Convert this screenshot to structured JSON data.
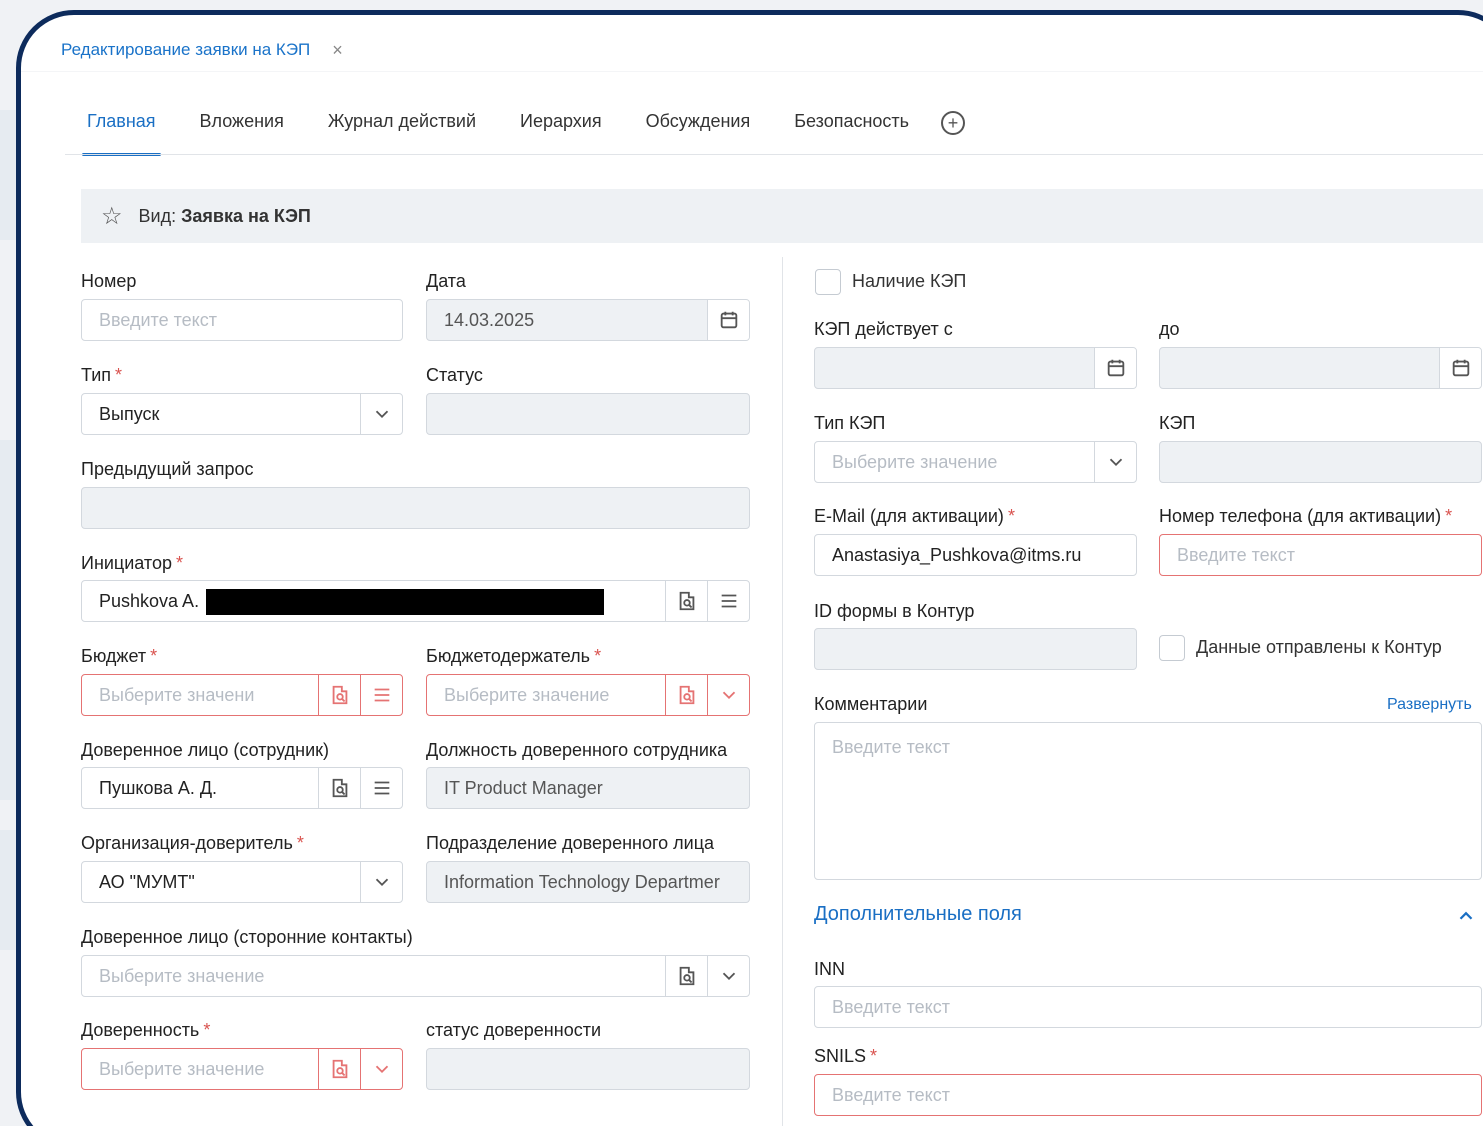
{
  "doc_tab": {
    "title": "Редактирование заявки на КЭП",
    "close": "×"
  },
  "tabs": [
    "Главная",
    "Вложения",
    "Журнал действий",
    "Иерархия",
    "Обсуждения",
    "Безопасность"
  ],
  "tab_add": "+",
  "view": {
    "label": "Вид:",
    "value": "Заявка на КЭП"
  },
  "left": {
    "nomer": {
      "label": "Номер",
      "placeholder": "Введите текст"
    },
    "data": {
      "label": "Дата",
      "value": "14.03.2025"
    },
    "tip": {
      "label": "Тип",
      "value": "Выпуск"
    },
    "status": {
      "label": "Статус",
      "value": ""
    },
    "prev": {
      "label": "Предыдущий запрос",
      "value": ""
    },
    "initiator": {
      "label": "Инициатор",
      "value": "Pushkova A."
    },
    "budget": {
      "label": "Бюджет",
      "placeholder": "Выберите значени"
    },
    "budget_holder": {
      "label": "Бюджетодержатель",
      "placeholder": "Выберите значение"
    },
    "trustee_emp": {
      "label": "Доверенное лицо (сотрудник)",
      "value": "Пушкова А. Д."
    },
    "trustee_pos": {
      "label": "Должность доверенного сотрудника",
      "value": "IT Product Manager"
    },
    "org": {
      "label": "Организация-доверитель",
      "value": "АО \"МУМТ\""
    },
    "subdiv": {
      "label": "Подразделение доверенного лица",
      "value": "Information Technology Departmer"
    },
    "trustee_ext": {
      "label": "Доверенное лицо (сторонние контакты)",
      "placeholder": "Выберите значение"
    },
    "poa": {
      "label": "Доверенность",
      "placeholder": "Выберите значение"
    },
    "poa_status": {
      "label": "статус доверенности",
      "value": ""
    }
  },
  "right": {
    "has_kep": {
      "label": "Наличие КЭП"
    },
    "valid_from": {
      "label": "КЭП действует с",
      "value": ""
    },
    "valid_to": {
      "label": "до",
      "value": ""
    },
    "kep_type": {
      "label": "Тип КЭП",
      "placeholder": "Выберите значение"
    },
    "kep": {
      "label": "КЭП",
      "value": ""
    },
    "email": {
      "label": "E-Mail (для активации)",
      "value": "Anastasiya_Pushkova@itms.ru"
    },
    "phone": {
      "label": "Номер телефона (для активации)",
      "placeholder": "Введите текст"
    },
    "kontur_id": {
      "label": "ID формы в Контур",
      "value": ""
    },
    "sent_kontur": {
      "label": "Данные отправлены к Контур"
    },
    "comments": {
      "label": "Комментарии",
      "expand": "Развернуть",
      "placeholder": "Введите текст"
    },
    "extra_section": "Дополнительные поля",
    "inn": {
      "label": "INN",
      "placeholder": "Введите текст"
    },
    "snils": {
      "label": "SNILS",
      "placeholder": "Введите текст"
    }
  },
  "required_mark": "*",
  "colors": {
    "accent": "#1a6fc4",
    "frame": "#0d2b5c",
    "error": "#e57373",
    "readonly": "#eef1f4"
  }
}
